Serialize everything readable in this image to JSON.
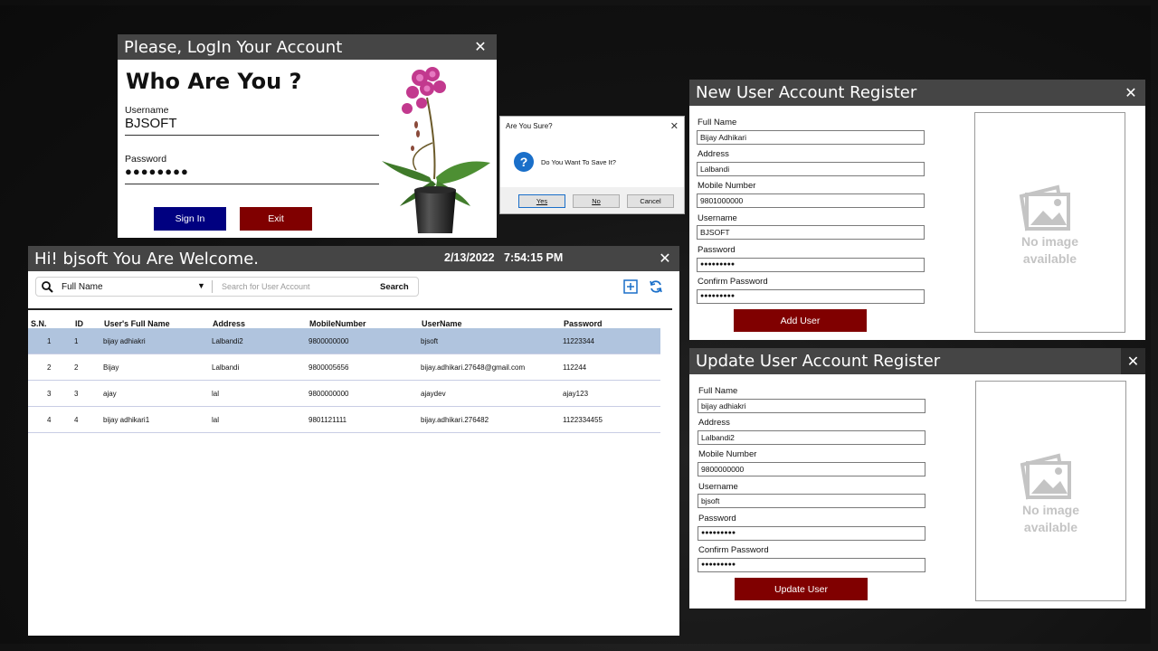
{
  "login": {
    "title": "Please, LogIn Your Account",
    "close": "✕",
    "heading": "Who Are You ?",
    "username_label": "Username",
    "username_value": "BJSOFT",
    "password_label": "Password",
    "password_value": "●●●●●●●●",
    "signin": "Sign In",
    "exit": "Exit"
  },
  "dialog": {
    "title": "Are You Sure?",
    "close": "✕",
    "icon": "?",
    "message": "Do You Want To Save It?",
    "yes": "Yes",
    "no": "No",
    "cancel": "Cancel"
  },
  "main": {
    "title": "Hi! bjsoft You Are Welcome.",
    "date": "2/13/2022",
    "time": "7:54:15 PM",
    "close": "✕",
    "filter_value": "Full Name",
    "search_placeholder": "Search for User Account",
    "search_button": "Search",
    "columns": [
      "S.N.",
      "ID",
      "User's Full Name",
      "Address",
      "MobileNumber",
      "UserName",
      "Password"
    ],
    "rows": [
      [
        "1",
        "1",
        "bijay adhiakri",
        "Lalbandi2",
        "9800000000",
        "bjsoft",
        "11223344"
      ],
      [
        "2",
        "2",
        "Bijay",
        "Lalbandi",
        "9800005656",
        "bijay.adhikari.27648@gmail.com",
        "112244"
      ],
      [
        "3",
        "3",
        "ajay",
        "lal",
        "9800000000",
        "ajaydev",
        "ajay123"
      ],
      [
        "4",
        "4",
        "bijay adhikari1",
        "lal",
        "9801121111",
        "bijay.adhikari.276482",
        "1122334455"
      ]
    ]
  },
  "newuser": {
    "title": "New User Account Register",
    "close": "✕",
    "fields": [
      {
        "label": "Full Name",
        "value": "Bijay Adhikari"
      },
      {
        "label": "Address",
        "value": "Lalbandi"
      },
      {
        "label": "Mobile Number",
        "value": "9801000000"
      },
      {
        "label": "Username",
        "value": "BJSOFT"
      },
      {
        "label": "Password",
        "value": "●●●●●●●●●"
      },
      {
        "label": "Confirm Password",
        "value": "●●●●●●●●●"
      }
    ],
    "button": "Add User",
    "noimage_line1": "No image",
    "noimage_line2": "available"
  },
  "updateuser": {
    "title": "Update User Account Register",
    "close": "✕",
    "fields": [
      {
        "label": "Full Name",
        "value": "bijay adhiakri"
      },
      {
        "label": "Address",
        "value": "Lalbandi2"
      },
      {
        "label": "Mobile Number",
        "value": "9800000000"
      },
      {
        "label": "Username",
        "value": "bjsoft"
      },
      {
        "label": "Password",
        "value": "●●●●●●●●●"
      },
      {
        "label": "Confirm Password",
        "value": "●●●●●●●●●"
      }
    ],
    "button": "Update User",
    "noimage_line1": "No image",
    "noimage_line2": "available"
  },
  "colors": {
    "titlebar": "#454545",
    "signin_button": "#000080",
    "danger_button": "#800000",
    "selected_row": "#b0c4de",
    "accent_icon": "#1a6fc9"
  }
}
